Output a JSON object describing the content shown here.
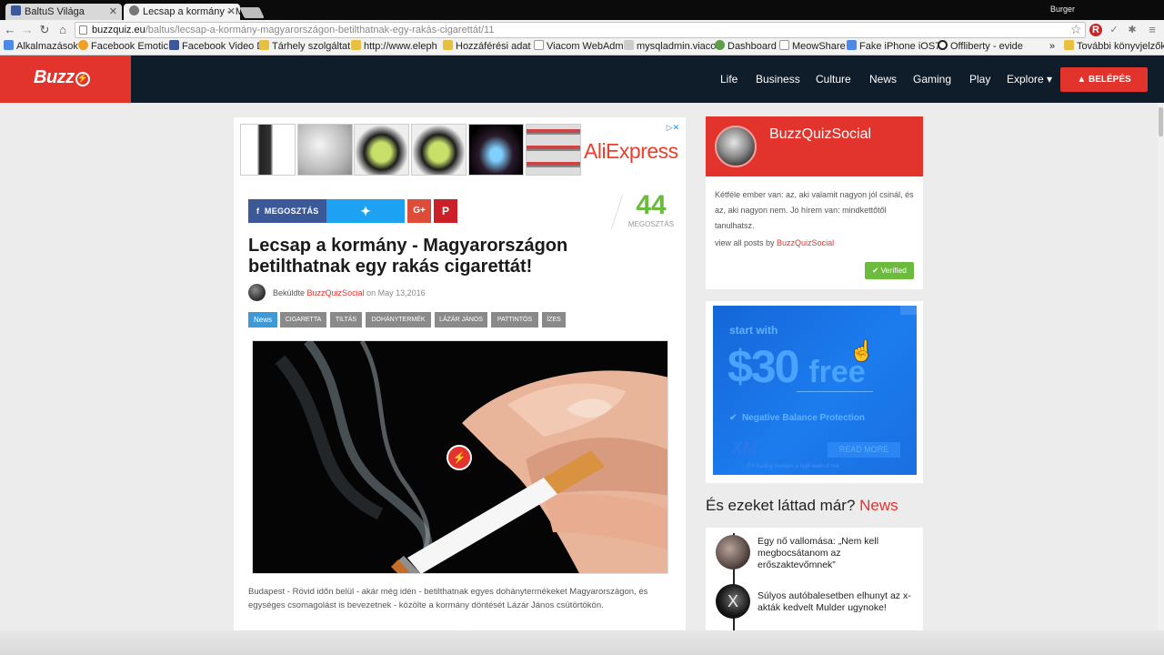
{
  "browser": {
    "tabs": [
      {
        "label": "BaltuS Világa",
        "icon_color": "#3b5998"
      },
      {
        "label": "Lecsap a kormány -  M",
        "icon_color": "#555555"
      }
    ],
    "profile_name": "Burger",
    "url_host": "buzzquiz.eu",
    "url_path": "/baltus/lecsap-a-kormány-magyarországon-betilthatnak-egy-rakás-cigarettát/11",
    "icons": [
      "back-icon",
      "forward-icon",
      "reload-icon",
      "home-icon",
      "star-icon",
      "menu-icon"
    ],
    "bookmarks": [
      {
        "label": "Alkalmazások",
        "icon_color": "#4d8ae8"
      },
      {
        "label": "Facebook Emotic",
        "icon_color": "#f0a020"
      },
      {
        "label": "Facebook Video D",
        "icon_color": "#3b5998"
      },
      {
        "label": "Tárhely szolgáltat",
        "icon_color": "#e8c040"
      },
      {
        "label": "http://www.eleph",
        "icon_color": "#e8c040"
      },
      {
        "label": "Hozzáférési adat",
        "icon_color": "#e8c040"
      },
      {
        "label": "Viacom WebAdm",
        "icon_color": "#cccccc"
      },
      {
        "label": "mysqladmin.viaco",
        "icon_color": "#cccccc"
      },
      {
        "label": "Dashboard",
        "icon_color": "#5c9e4a"
      },
      {
        "label": "MeowShare",
        "icon_color": "#cccccc"
      },
      {
        "label": "Fake iPhone iOS7",
        "icon_color": "#4d8ae8"
      },
      {
        "label": "Offliberty - evide",
        "icon_color": "#222222"
      },
      {
        "label": "»",
        "icon_color": ""
      },
      {
        "label": "További könyvjelzők",
        "icon_color": "#e8c040"
      }
    ]
  },
  "site": {
    "logo": "Buzz",
    "logo_icon": "⚡",
    "nav": [
      "Life",
      "Business",
      "Culture",
      "News",
      "Gaming",
      "Play",
      "Explore ▾"
    ],
    "login_label": "BELÉPÉS",
    "brand_color": "#e2342d",
    "header_color": "#0f1c2a"
  },
  "ad": {
    "brand": "AliExpress",
    "close_label": "▷✕"
  },
  "share": {
    "facebook_label": "MEGOSZTÁS",
    "twitter_icon": "🐦",
    "gplus_label": "G+",
    "pinterest_label": "P",
    "count": "44",
    "count_label": "MEGOSZTÁS"
  },
  "article": {
    "title": "Lecsap a kormány - Magyarországon betilthatnak egy rakás cigarettát!",
    "byline_prefix": "Beküldte",
    "author": "BuzzQuizSocial",
    "date": "on May 13,2016",
    "tags": [
      "News",
      "CIGARETTA",
      "TILTÁS",
      "DOHÁNYTERMÉK",
      "LÁZÁR JÁNOS",
      "PATTINTÓS",
      "ÍZES"
    ],
    "photo_badge": "⚡",
    "body": "Budapest - Rövid időn belül - akár még idén - betilthatnak egyes dohánytermékeket Magyarországon, és egységes csomagolást is bevezetnek - közölte a kormány döntését Lázár János csütörtökön."
  },
  "author_card": {
    "name": "BuzzQuizSocial",
    "bio": "Kétféle ember van: az, aki valamit nagyon jól csinál, és az, aki nagyon nem. Jó hírem van: mindkettőtől tanulhatsz.",
    "posts_prefix": "view all posts by",
    "posts_author": "BuzzQuizSocial",
    "verified_label": "Verified"
  },
  "side_ad": {
    "start": "start with",
    "amount": "$30",
    "free": "free",
    "feature": "Negative Balance Protection",
    "logo": "XM",
    "button": "READ MORE",
    "fine_print": "FX trading involves a high level of risk"
  },
  "related": {
    "title_prefix": "És ezeket láttad már?",
    "title_accent": "News",
    "items": [
      {
        "text": "Egy nő vallomása: „Nem kell megbocsátanom az erőszaktevőmnek”"
      },
      {
        "text": "Súlyos autóbalesetben elhunyt az x-akták kedvelt Mulder ugynoke!"
      }
    ]
  }
}
